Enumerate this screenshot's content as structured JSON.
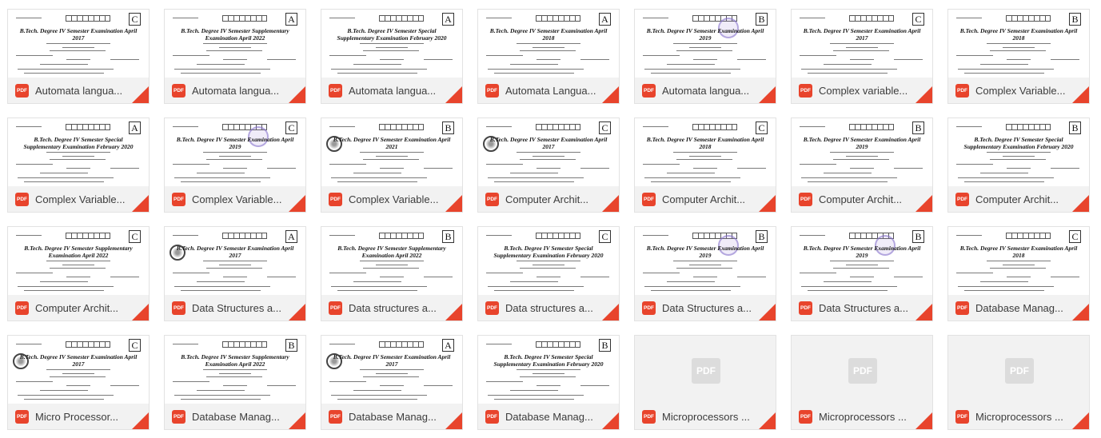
{
  "files": [
    {
      "title": "Automata langua...",
      "letter": "C",
      "doc_title": "B.Tech. Degree IV Semester Examination April 2017",
      "thumb": true,
      "seal": false,
      "stamp": false
    },
    {
      "title": "Automata langua...",
      "letter": "A",
      "doc_title": "B.Tech. Degree IV Semester Supplementary Examination April 2022",
      "thumb": true,
      "seal": false,
      "stamp": false
    },
    {
      "title": "Automata langua...",
      "letter": "A",
      "doc_title": "B.Tech. Degree IV Semester Special Supplementary Examination February 2020",
      "thumb": true,
      "seal": false,
      "stamp": false
    },
    {
      "title": "Automata Langua...",
      "letter": "A",
      "doc_title": "B.Tech. Degree IV Semester Examination April 2018",
      "thumb": true,
      "seal": false,
      "stamp": false
    },
    {
      "title": "Automata langua...",
      "letter": "B",
      "doc_title": "B.Tech. Degree IV Semester Examination April 2019",
      "thumb": true,
      "seal": false,
      "stamp": true
    },
    {
      "title": "Complex variable...",
      "letter": "C",
      "doc_title": "B.Tech. Degree IV Semester Examination April 2017",
      "thumb": true,
      "seal": false,
      "stamp": false
    },
    {
      "title": "Complex Variable...",
      "letter": "B",
      "doc_title": "B.Tech. Degree IV Semester Examination April 2018",
      "thumb": true,
      "seal": false,
      "stamp": false
    },
    {
      "title": "Complex Variable...",
      "letter": "A",
      "doc_title": "B.Tech. Degree IV Semester Special Supplementary Examination February 2020",
      "thumb": true,
      "seal": false,
      "stamp": false
    },
    {
      "title": "Complex Variable...",
      "letter": "C",
      "doc_title": "B.Tech. Degree IV Semester Examination April 2019",
      "thumb": true,
      "seal": false,
      "stamp": true
    },
    {
      "title": "Complex Variable...",
      "letter": "B",
      "doc_title": "B.Tech. Degree IV Semester Examination April 2021",
      "thumb": true,
      "seal": true,
      "stamp": false
    },
    {
      "title": "Computer Archit...",
      "letter": "C",
      "doc_title": "B.Tech. Degree IV Semester Examination April 2017",
      "thumb": true,
      "seal": true,
      "stamp": false
    },
    {
      "title": "Computer Archit...",
      "letter": "C",
      "doc_title": "B.Tech. Degree IV Semester Examination April 2018",
      "thumb": true,
      "seal": false,
      "stamp": false
    },
    {
      "title": "Computer Archit...",
      "letter": "B",
      "doc_title": "B.Tech. Degree IV Semester Examination April 2019",
      "thumb": true,
      "seal": false,
      "stamp": false
    },
    {
      "title": "Computer Archit...",
      "letter": "B",
      "doc_title": "B.Tech. Degree IV Semester Special Supplementary Examination February 2020",
      "thumb": true,
      "seal": false,
      "stamp": false
    },
    {
      "title": "Computer Archit...",
      "letter": "C",
      "doc_title": "B.Tech. Degree IV Semester Supplementary Examination April 2022",
      "thumb": true,
      "seal": false,
      "stamp": false
    },
    {
      "title": "Data Structures a...",
      "letter": "A",
      "doc_title": "B.Tech. Degree IV Semester Examination April 2017",
      "thumb": true,
      "seal": true,
      "stamp": false
    },
    {
      "title": "Data structures a...",
      "letter": "B",
      "doc_title": "B.Tech. Degree IV Semester Supplementary Examination April 2022",
      "thumb": true,
      "seal": false,
      "stamp": false
    },
    {
      "title": "Data structures a...",
      "letter": "C",
      "doc_title": "B.Tech. Degree IV Semester Special Supplementary Examination February 2020",
      "thumb": true,
      "seal": false,
      "stamp": false
    },
    {
      "title": "Data Structures a...",
      "letter": "B",
      "doc_title": "B.Tech. Degree IV Semester Examination April 2019",
      "thumb": true,
      "seal": false,
      "stamp": true
    },
    {
      "title": "Data Structures a...",
      "letter": "B",
      "doc_title": "B.Tech. Degree IV Semester Examination April 2019",
      "thumb": true,
      "seal": false,
      "stamp": true
    },
    {
      "title": "Database Manag...",
      "letter": "C",
      "doc_title": "B.Tech. Degree IV Semester Examination April 2018",
      "thumb": true,
      "seal": false,
      "stamp": false
    },
    {
      "title": "Micro Processor...",
      "letter": "C",
      "doc_title": "B.Tech. Degree IV Semester Examination April 2017",
      "thumb": true,
      "seal": true,
      "stamp": false
    },
    {
      "title": "Database Manag...",
      "letter": "B",
      "doc_title": "B.Tech. Degree IV Semester Supplementary Examination April 2022",
      "thumb": true,
      "seal": false,
      "stamp": false
    },
    {
      "title": "Database Manag...",
      "letter": "A",
      "doc_title": "B.Tech. Degree IV Semester Examination April 2017",
      "thumb": true,
      "seal": true,
      "stamp": false
    },
    {
      "title": "Database Manag...",
      "letter": "B",
      "doc_title": "B.Tech. Degree IV Semester Special Supplementary Examination February 2020",
      "thumb": true,
      "seal": false,
      "stamp": false
    },
    {
      "title": "Microprocessors ...",
      "letter": "",
      "doc_title": "",
      "thumb": false,
      "seal": false,
      "stamp": false
    },
    {
      "title": "Microprocessors ...",
      "letter": "",
      "doc_title": "",
      "thumb": false,
      "seal": false,
      "stamp": false
    },
    {
      "title": "Microprocessors ...",
      "letter": "",
      "doc_title": "",
      "thumb": false,
      "seal": false,
      "stamp": false
    }
  ],
  "labels": {
    "pdf_badge": "PDF",
    "pdf_placeholder": "PDF"
  },
  "colors": {
    "accent": "#e8442c",
    "bar": "#f2f2f2",
    "stamp": "#8f7fd0"
  },
  "icons": {
    "file_type": "pdf-icon",
    "corner": "pdf-corner-icon"
  }
}
